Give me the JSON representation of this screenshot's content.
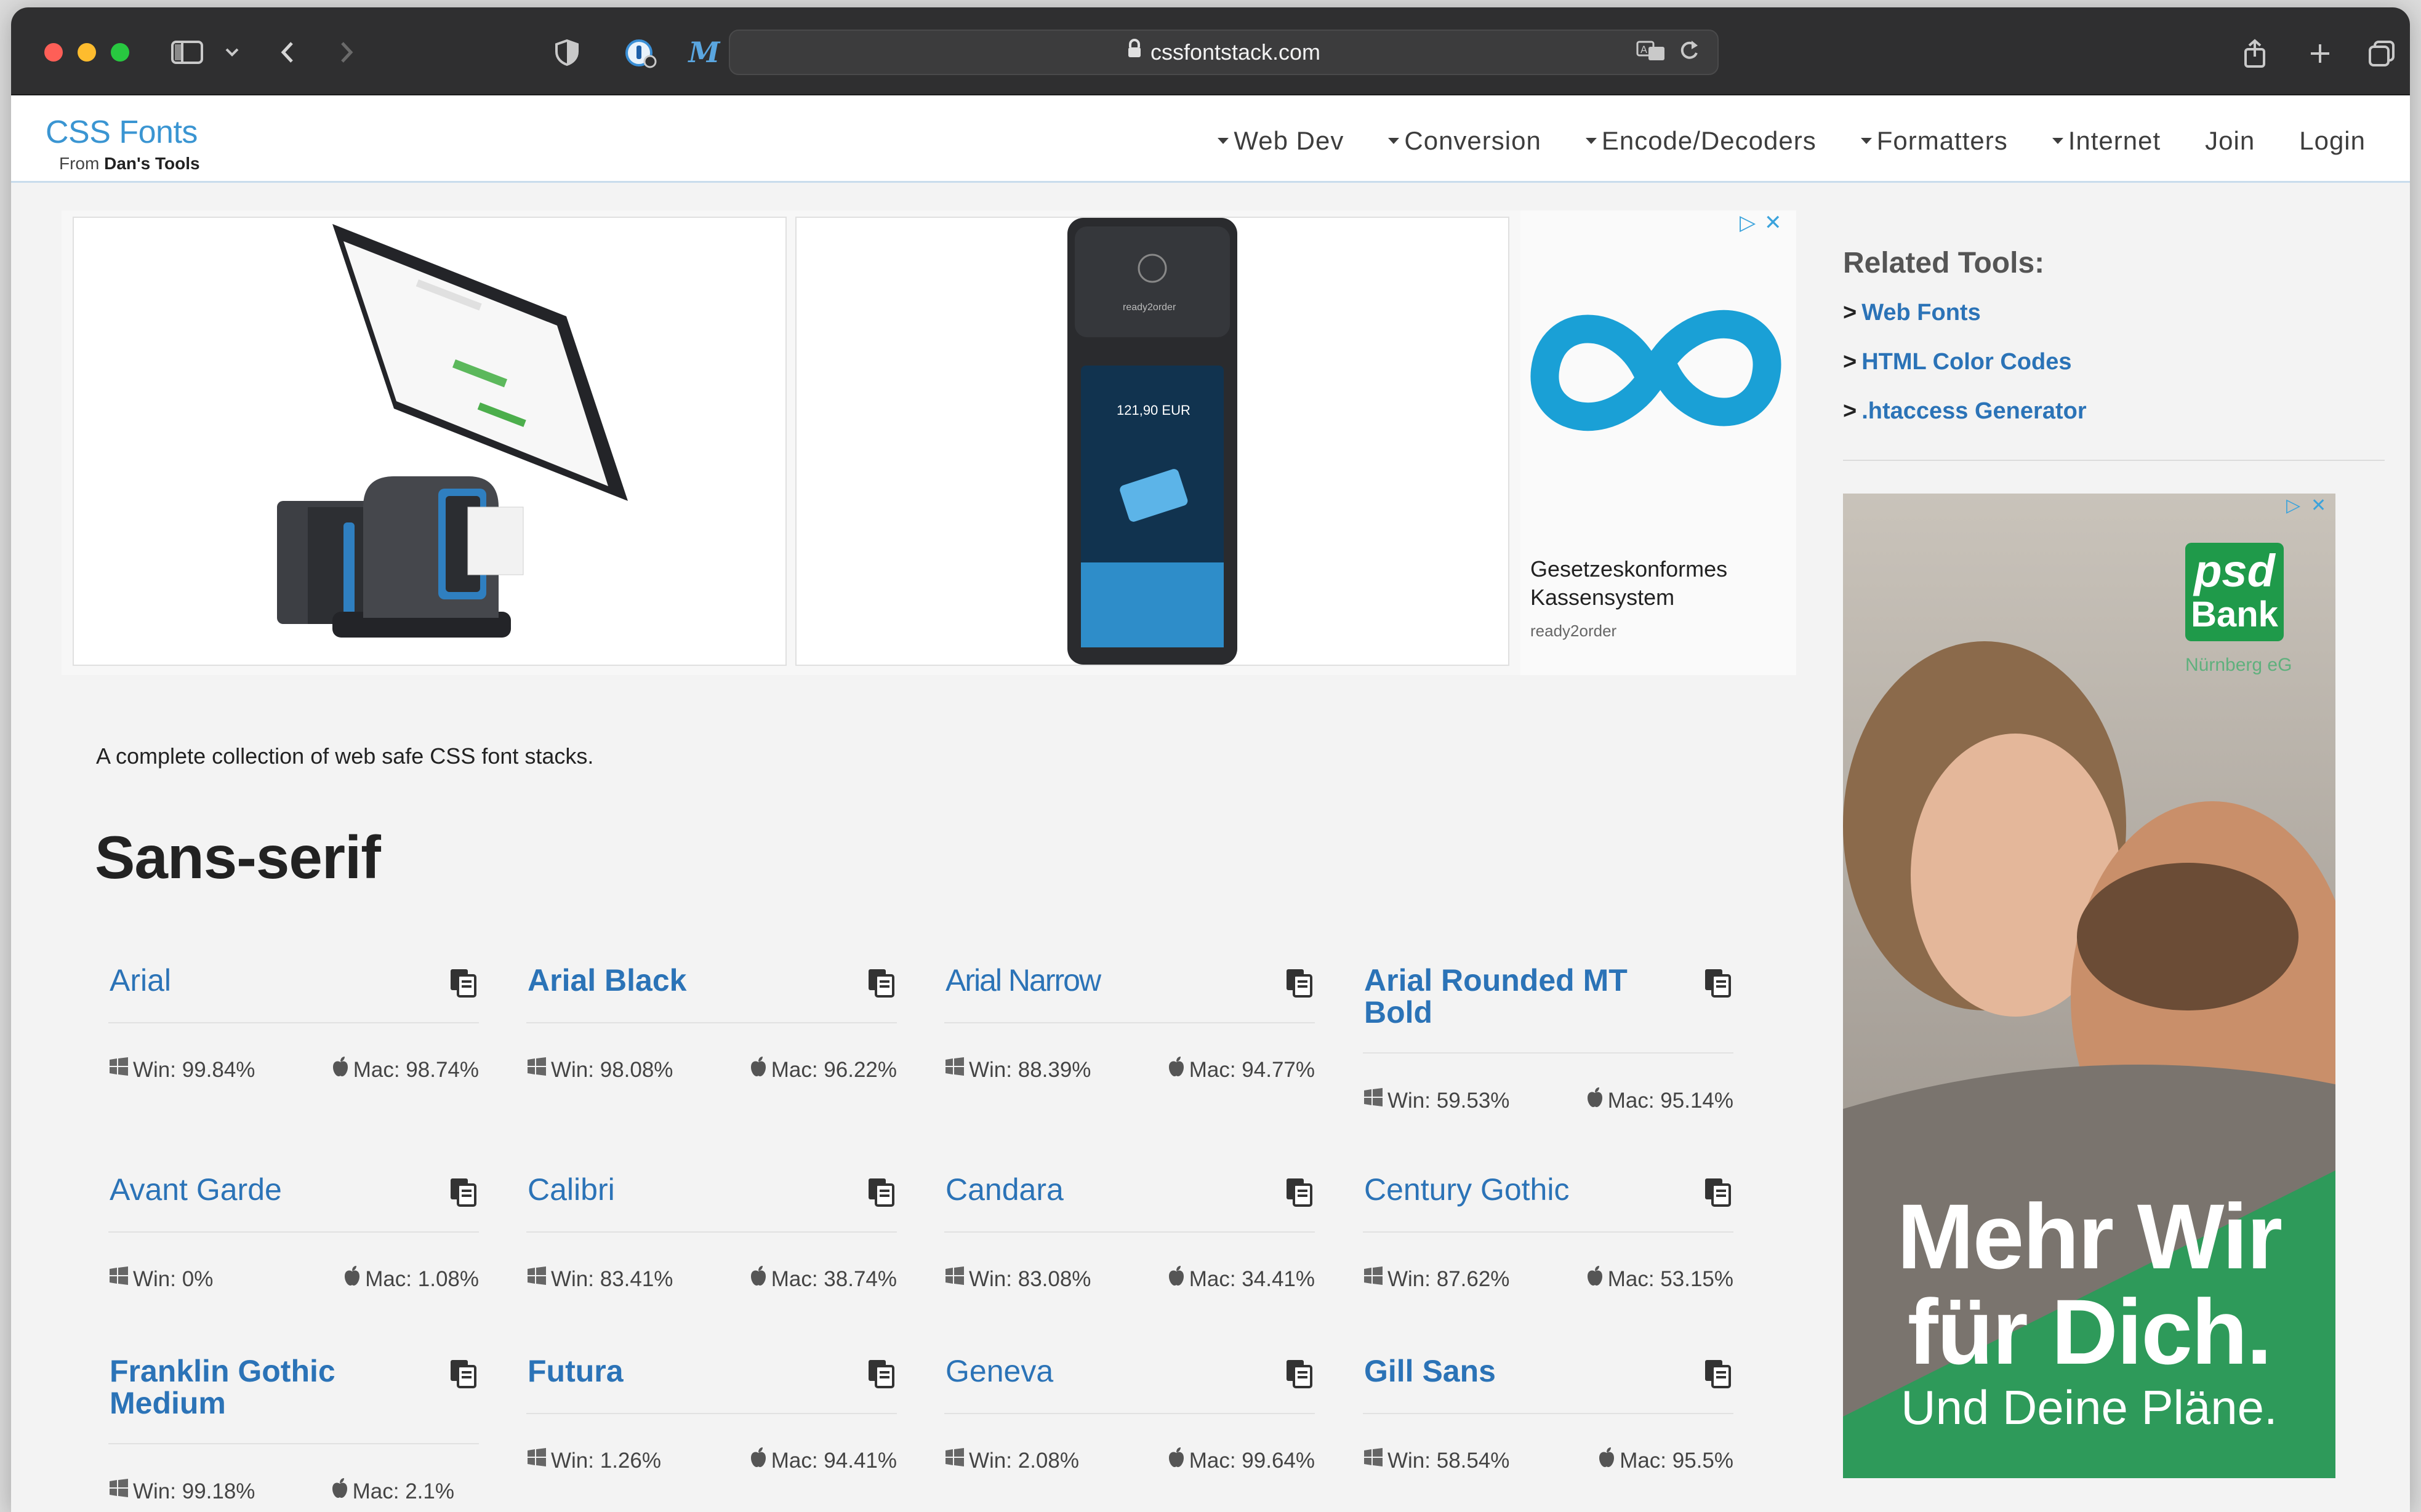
{
  "browser": {
    "url": "cssfontstack.com"
  },
  "header": {
    "logo_title": "CSS Fonts",
    "logo_from": "From",
    "logo_brand": "Dan's Tools",
    "nav": [
      {
        "label": "Web Dev",
        "dropdown": true
      },
      {
        "label": "Conversion",
        "dropdown": true
      },
      {
        "label": "Encode/Decoders",
        "dropdown": true
      },
      {
        "label": "Formatters",
        "dropdown": true
      },
      {
        "label": "Internet",
        "dropdown": true
      },
      {
        "label": "Join",
        "dropdown": false
      },
      {
        "label": "Login",
        "dropdown": false
      }
    ]
  },
  "ad_banner": {
    "card2_price": "121,90 EUR",
    "card2_brand": "ready2order",
    "headline": "Gesetzeskonformes Kassensystem",
    "advertiser": "ready2order"
  },
  "main": {
    "intro": "A complete collection of web safe CSS font stacks.",
    "section_title": "Sans-serif",
    "fonts": [
      {
        "name": "Arial",
        "win": "Win: 99.84%",
        "mac": "Mac: 98.74%"
      },
      {
        "name": "Arial Black",
        "win": "Win: 98.08%",
        "mac": "Mac: 96.22%"
      },
      {
        "name": "Arial Narrow",
        "win": "Win: 88.39%",
        "mac": "Mac: 94.77%"
      },
      {
        "name": "Arial Rounded MT Bold",
        "win": "Win: 59.53%",
        "mac": "Mac: 95.14%"
      },
      {
        "name": "Avant Garde",
        "win": "Win: 0%",
        "mac": "Mac: 1.08%"
      },
      {
        "name": "Calibri",
        "win": "Win: 83.41%",
        "mac": "Mac: 38.74%"
      },
      {
        "name": "Candara",
        "win": "Win: 83.08%",
        "mac": "Mac: 34.41%"
      },
      {
        "name": "Century Gothic",
        "win": "Win: 87.62%",
        "mac": "Mac: 53.15%"
      },
      {
        "name": "Franklin Gothic Medium",
        "win": "Win: 99.18%",
        "mac": "Mac: 2.1%"
      },
      {
        "name": "Futura",
        "win": "Win: 1.26%",
        "mac": "Mac: 94.41%"
      },
      {
        "name": "Geneva",
        "win": "Win: 2.08%",
        "mac": "Mac: 99.64%"
      },
      {
        "name": "Gill Sans",
        "win": "Win: 58.54%",
        "mac": "Mac: 95.5%"
      }
    ]
  },
  "sidebar": {
    "related_title": "Related Tools:",
    "related_tools": [
      "Web Fonts",
      "HTML Color Codes",
      ".htaccess Generator"
    ],
    "ad": {
      "logo_line1": "psd",
      "logo_line2": "Bank",
      "logo_sub": "Nürnberg eG",
      "headline_line1": "Mehr Wir",
      "headline_line2": "für Dich.",
      "tagline": "Und Deine Pläne."
    }
  },
  "colors": {
    "link_blue": "#2b73b7",
    "logo_blue": "#3a95d2",
    "chrome_dark": "#2f2f30",
    "psd_green": "#1f9a4a"
  }
}
